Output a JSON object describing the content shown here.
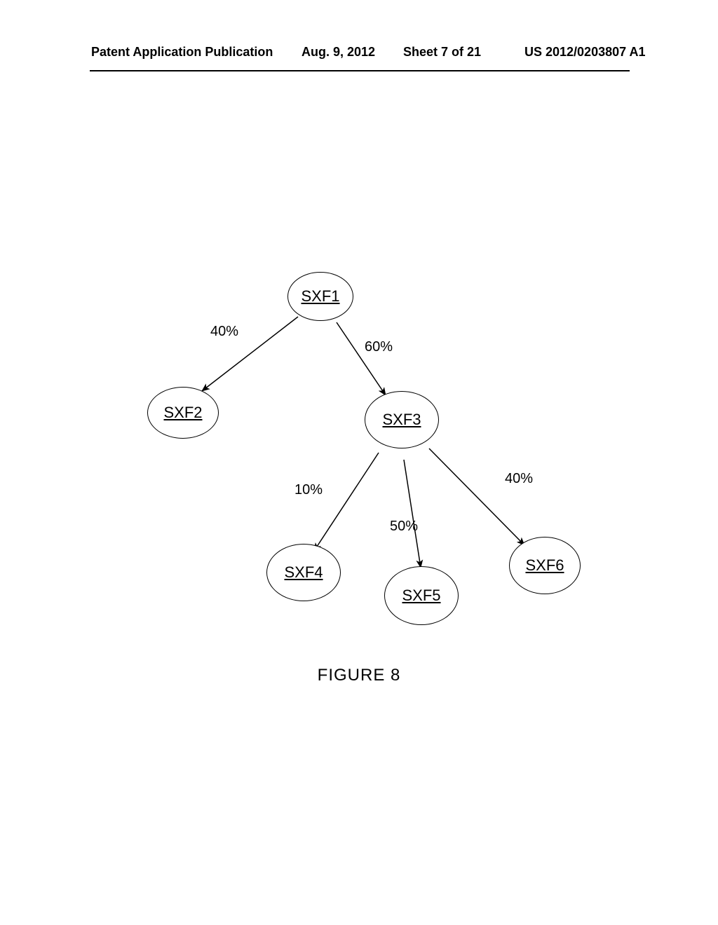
{
  "header": {
    "publication_left": "Patent Application Publication",
    "date": "Aug. 9, 2012",
    "sheet": "Sheet 7 of 21",
    "publication_number": "US 2012/0203807 A1"
  },
  "nodes": {
    "sxf1": "SXF1",
    "sxf2": "SXF2",
    "sxf3": "SXF3",
    "sxf4": "SXF4",
    "sxf5": "SXF5",
    "sxf6": "SXF6"
  },
  "edges": {
    "sxf1_sxf2": "40%",
    "sxf1_sxf3": "60%",
    "sxf3_sxf4": "10%",
    "sxf3_sxf5": "50%",
    "sxf3_sxf6": "40%"
  },
  "caption": "FIGURE 8",
  "chart_data": {
    "type": "tree",
    "description": "Weighted directed tree of SXF nodes",
    "nodes": [
      "SXF1",
      "SXF2",
      "SXF3",
      "SXF4",
      "SXF5",
      "SXF6"
    ],
    "edges": [
      {
        "from": "SXF1",
        "to": "SXF2",
        "weight_percent": 40
      },
      {
        "from": "SXF1",
        "to": "SXF3",
        "weight_percent": 60
      },
      {
        "from": "SXF3",
        "to": "SXF4",
        "weight_percent": 10
      },
      {
        "from": "SXF3",
        "to": "SXF5",
        "weight_percent": 50
      },
      {
        "from": "SXF3",
        "to": "SXF6",
        "weight_percent": 40
      }
    ]
  }
}
